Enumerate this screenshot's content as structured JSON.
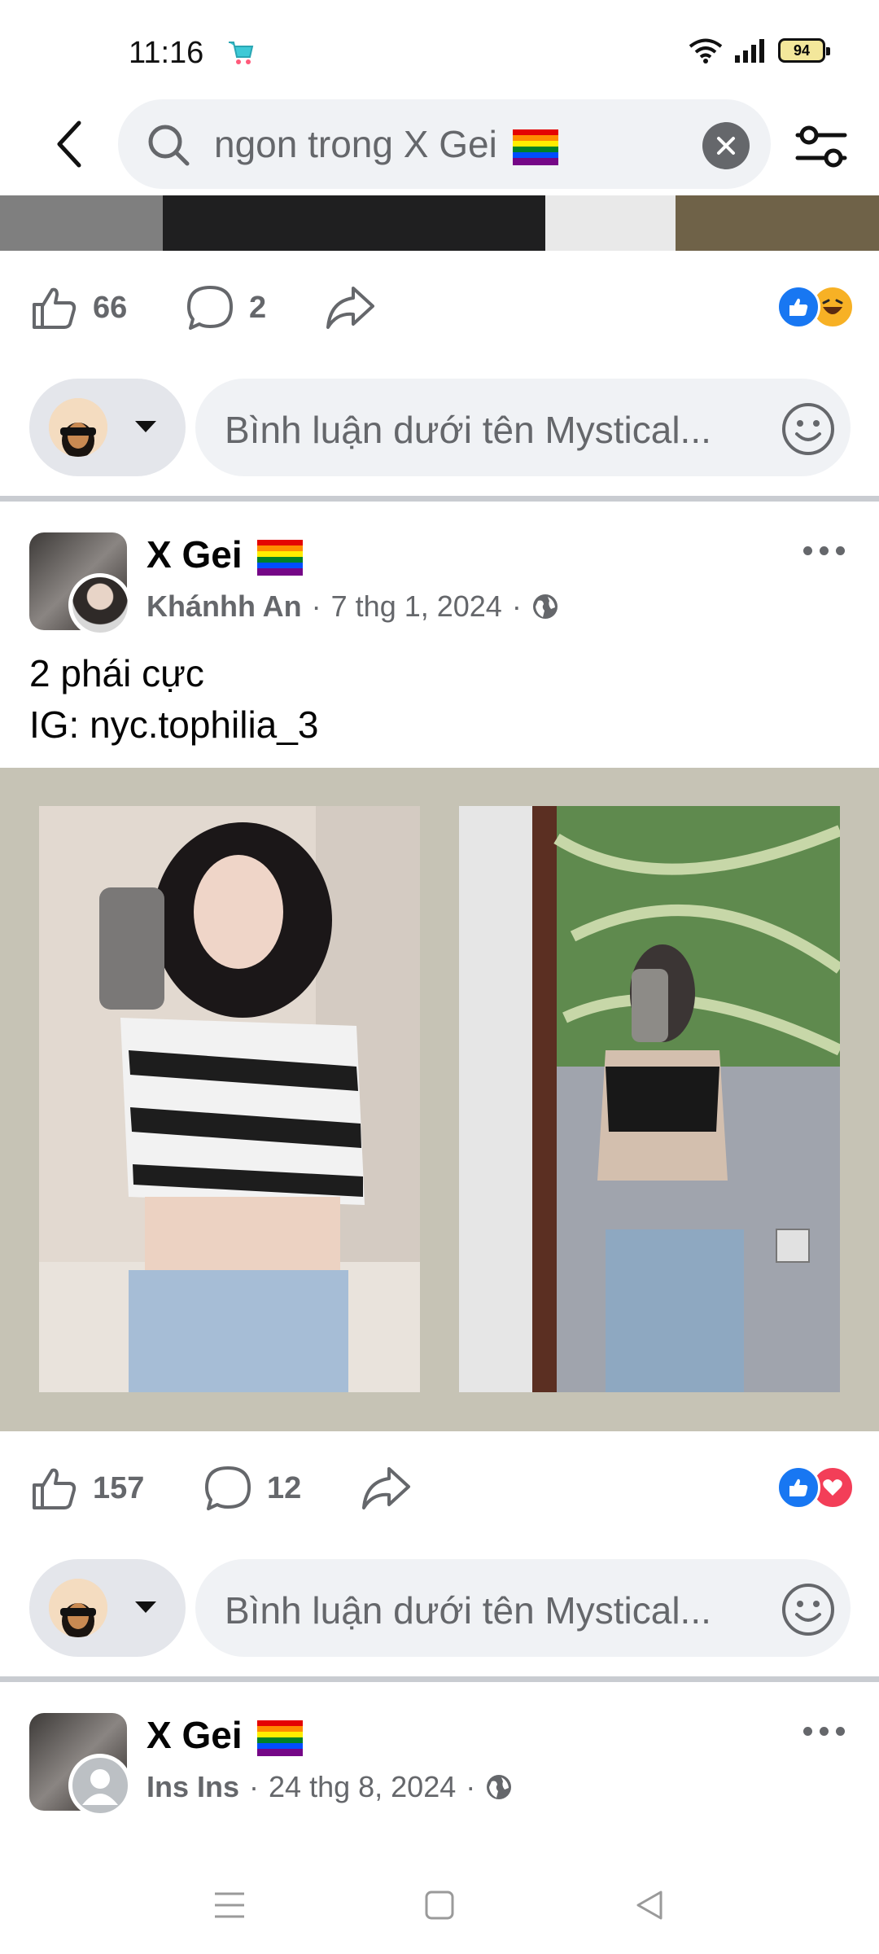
{
  "status_bar": {
    "time": "11:16",
    "battery": "94"
  },
  "search": {
    "query": "ngon trong X Gei"
  },
  "post1": {
    "likes": "66",
    "comments": "2"
  },
  "comment_box": {
    "placeholder": "Bình luận dưới tên Mystical..."
  },
  "post2": {
    "group": "X Gei",
    "author": "Khánhh An",
    "date": "7 thg 1, 2024",
    "text_line1": "2 phái cực",
    "text_line2": "IG: nyc.tophilia_3",
    "likes": "157",
    "comments": "12"
  },
  "post3": {
    "group": "X Gei",
    "author": "Ins Ins",
    "date": "24 thg 8, 2024"
  },
  "colors": {
    "like_blue": "#1877f2",
    "love_red": "#f33e58",
    "haha_yellow": "#f7b125"
  },
  "icons": [
    "back-arrow-icon",
    "search-icon",
    "clear-icon",
    "filter-icon",
    "like-icon",
    "comment-icon",
    "share-icon",
    "emoji-icon",
    "globe-icon",
    "more-icon",
    "menu-icon",
    "home-icon",
    "back-nav-icon"
  ]
}
